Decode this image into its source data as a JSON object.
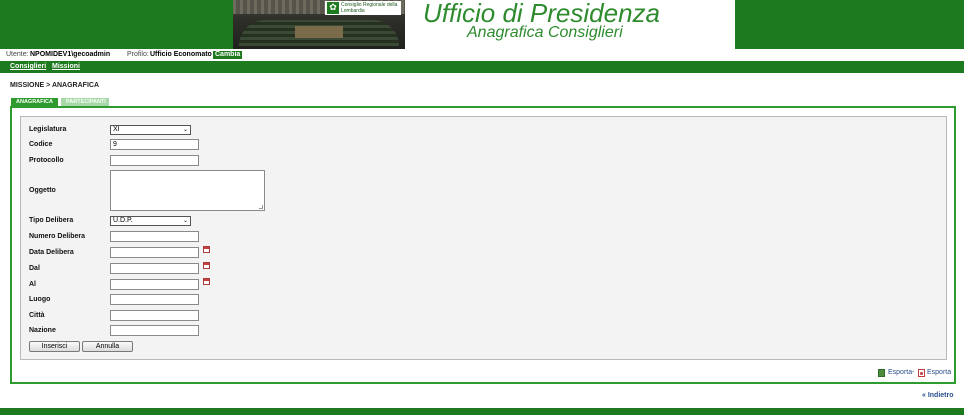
{
  "header": {
    "logo_text": "Consiglio Regionale della Lombardia",
    "title": "Ufficio di Presidenza",
    "subtitle": "Anagrafica Consiglieri"
  },
  "userbar": {
    "user_label": "Utente:",
    "user_value": "NPOMIDEV1\\gecoadmin",
    "profile_label": "Profilo:",
    "profile_value": "Ufficio Economato",
    "change_label": "Cambia"
  },
  "nav": {
    "items": [
      {
        "label": "Consiglieri"
      },
      {
        "label": "Missioni"
      }
    ]
  },
  "breadcrumb": "MISSIONE > ANAGRAFICA",
  "tabs": [
    {
      "label": "ANAGRAFICA",
      "active": true
    },
    {
      "label": "PARTECIPANTI",
      "active": false
    }
  ],
  "form": {
    "legislatura": {
      "label": "Legislatura",
      "value": "XI"
    },
    "codice": {
      "label": "Codice",
      "value": "9"
    },
    "protocollo": {
      "label": "Protocollo",
      "value": ""
    },
    "oggetto": {
      "label": "Oggetto",
      "value": ""
    },
    "tipo_delibera": {
      "label": "Tipo Delibera",
      "value": "U.D.P."
    },
    "numero_delibera": {
      "label": "Numero Delibera",
      "value": ""
    },
    "data_delibera": {
      "label": "Data Delibera",
      "value": ""
    },
    "dal": {
      "label": "Dal",
      "value": ""
    },
    "al": {
      "label": "Al",
      "value": ""
    },
    "luogo": {
      "label": "Luogo",
      "value": ""
    },
    "citta": {
      "label": "Città",
      "value": ""
    },
    "nazione": {
      "label": "Nazione",
      "value": ""
    },
    "insert_label": "Inserisci",
    "cancel_label": "Annulla"
  },
  "export": {
    "excel_label": "Esporta",
    "separator": "-",
    "pdf_label": "Esporta"
  },
  "back_label": "« Indietro",
  "colors": {
    "brand_green": "#1e7a1e",
    "tab_active": "#2e9b2e",
    "link_blue": "#2a4f8a"
  }
}
